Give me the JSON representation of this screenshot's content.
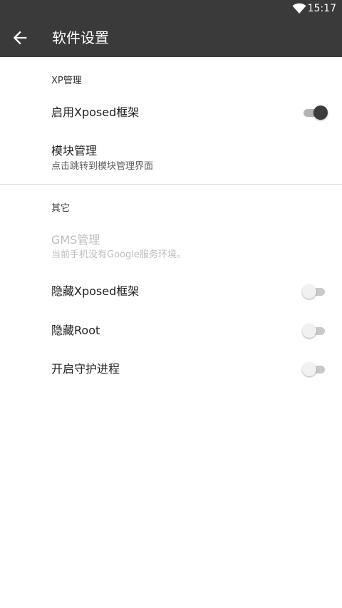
{
  "status_bar": {
    "time": "15:17",
    "wifi_icon": "wifi-icon"
  },
  "app_bar": {
    "title": "软件设置",
    "back_icon": "arrow-left-icon"
  },
  "section_xp": {
    "header": "XP管理",
    "enable_xposed": {
      "title": "启用Xposed框架",
      "checked": true
    },
    "module_manage": {
      "title": "模块管理",
      "summary": "点击跳转到模块管理界面"
    }
  },
  "section_other": {
    "header": "其它",
    "gms_manage": {
      "title": "GMS管理",
      "summary": "当前手机没有Google服务环境。",
      "enabled": false
    },
    "hide_xposed": {
      "title": "隐藏Xposed框架",
      "checked": false
    },
    "hide_root": {
      "title": "隐藏Root",
      "checked": false
    },
    "guard_process": {
      "title": "开启守护进程",
      "checked": false
    }
  },
  "colors": {
    "app_bar": "#3a3a3a",
    "switch_on_thumb": "#3c3c3c",
    "switch_off_thumb": "#f1f1f1",
    "disabled_text": "#bdbdbd"
  }
}
